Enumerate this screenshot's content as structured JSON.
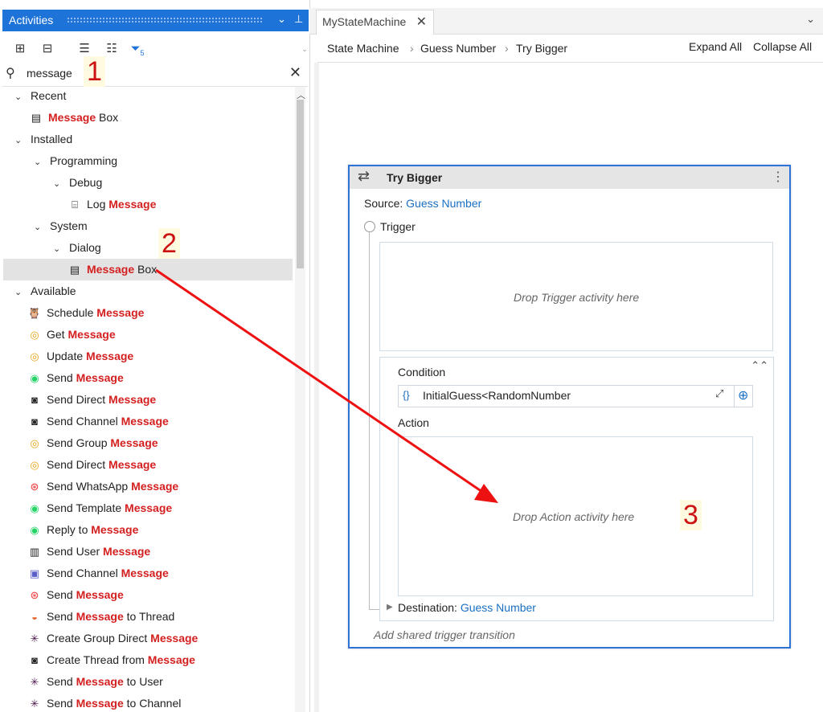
{
  "panel": {
    "title": "Activities",
    "search_value": "message"
  },
  "tree": [
    {
      "label": "Recent",
      "chev": "⌄",
      "type": "group"
    },
    {
      "pre": "",
      "hl": "Message",
      "post": " Box",
      "icon": "message-box-icon"
    },
    {
      "label": "Installed",
      "chev": "⌄",
      "type": "group"
    },
    {
      "label": "Programming",
      "chev": "⌄",
      "type": "group"
    },
    {
      "label": "Debug",
      "chev": "⌄",
      "type": "group"
    },
    {
      "pre": "Log ",
      "hl": "Message",
      "post": "",
      "icon": "log-icon"
    },
    {
      "label": "System",
      "chev": "⌄",
      "type": "group"
    },
    {
      "label": "Dialog",
      "chev": "⌄",
      "type": "group"
    },
    {
      "pre": "",
      "hl": "Message",
      "post": " Box",
      "icon": "message-box-icon"
    },
    {
      "label": "Available",
      "chev": "⌄",
      "type": "group"
    },
    {
      "pre": "Schedule ",
      "hl": "Message",
      "post": "",
      "icon": "hootsuite-icon"
    },
    {
      "pre": "Get ",
      "hl": "Message",
      "post": "",
      "icon": "ring-icon"
    },
    {
      "pre": "Update ",
      "hl": "Message",
      "post": "",
      "icon": "ring-icon"
    },
    {
      "pre": "Send ",
      "hl": "Message",
      "post": "",
      "icon": "whatsapp-icon"
    },
    {
      "pre": "Send Direct ",
      "hl": "Message",
      "post": "",
      "icon": "discord-icon"
    },
    {
      "pre": "Send Channel ",
      "hl": "Message",
      "post": "",
      "icon": "discord-icon"
    },
    {
      "pre": "Send Group ",
      "hl": "Message",
      "post": "",
      "icon": "ring-icon"
    },
    {
      "pre": "Send Direct ",
      "hl": "Message",
      "post": "",
      "icon": "ring-icon"
    },
    {
      "pre": "Send WhatsApp ",
      "hl": "Message",
      "post": "",
      "icon": "twilio-icon"
    },
    {
      "pre": "Send Template ",
      "hl": "Message",
      "post": "",
      "icon": "whatsapp-icon"
    },
    {
      "pre": "Reply to ",
      "hl": "Message",
      "post": "",
      "icon": "whatsapp-icon"
    },
    {
      "pre": "Send User ",
      "hl": "Message",
      "post": "",
      "icon": "intercom-icon"
    },
    {
      "pre": "Send Channel ",
      "hl": "Message",
      "post": "",
      "icon": "teams-icon"
    },
    {
      "pre": "Send ",
      "hl": "Message",
      "post": "",
      "icon": "twilio-icon"
    },
    {
      "pre": "Send ",
      "hl": "Message",
      "post": " to Thread",
      "icon": "chat-icon"
    },
    {
      "pre": "Create Group Direct ",
      "hl": "Message",
      "post": "",
      "icon": "slack-icon"
    },
    {
      "pre": "Create Thread from ",
      "hl": "Message",
      "post": "",
      "icon": "discord-icon"
    },
    {
      "pre": "Send ",
      "hl": "Message",
      "post": " to User",
      "icon": "slack-icon"
    },
    {
      "pre": "Send ",
      "hl": "Message",
      "post": " to Channel",
      "icon": "slack-icon"
    }
  ],
  "tab": {
    "label": "MyStateMachine"
  },
  "breadcrumb": {
    "items": [
      "State Machine",
      "Guess Number",
      "Try Bigger"
    ],
    "expand_all": "Expand All",
    "collapse_all": "Collapse All"
  },
  "card": {
    "title": "Try Bigger",
    "source_label": "Source:",
    "source_value": "Guess Number",
    "trigger_label": "Trigger",
    "trigger_placeholder": "Drop Trigger activity here",
    "condition_label": "Condition",
    "condition_value": "InitialGuess<RandomNumber",
    "action_label": "Action",
    "action_placeholder": "Drop Action activity here",
    "destination_label": "Destination:",
    "destination_value": "Guess Number",
    "shared_trigger": "Add shared trigger transition"
  },
  "annotations": {
    "one": "1",
    "two": "2",
    "three": "3"
  },
  "colors": {
    "accent": "#1e73d8",
    "highlight": "#d42020",
    "link": "#1a6fc4",
    "arrow": "#ee1111"
  }
}
